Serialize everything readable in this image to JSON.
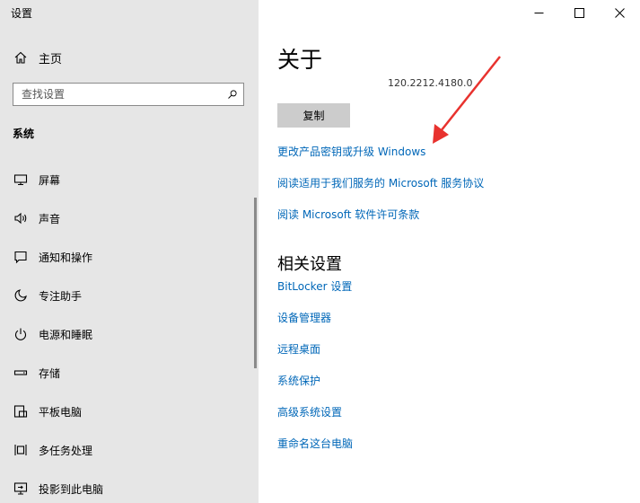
{
  "window": {
    "title": "设置",
    "controls": {
      "minimize_icon": "minimize-icon",
      "maximize_icon": "maximize-icon",
      "close_icon": "close-icon"
    }
  },
  "sidebar": {
    "home": {
      "label": "主页",
      "icon": "home-icon"
    },
    "search": {
      "placeholder": "查找设置",
      "icon": "search-icon"
    },
    "section": "系统",
    "items": [
      {
        "label": "屏幕",
        "icon": "display-icon"
      },
      {
        "label": "声音",
        "icon": "speaker-icon"
      },
      {
        "label": "通知和操作",
        "icon": "notification-icon"
      },
      {
        "label": "专注助手",
        "icon": "moon-icon"
      },
      {
        "label": "电源和睡眠",
        "icon": "power-icon"
      },
      {
        "label": "存储",
        "icon": "storage-icon"
      },
      {
        "label": "平板电脑",
        "icon": "tablet-icon"
      },
      {
        "label": "多任务处理",
        "icon": "multitask-icon"
      },
      {
        "label": "投影到此电脑",
        "icon": "project-icon"
      }
    ]
  },
  "main": {
    "title": "关于",
    "version": "120.2212.4180.0",
    "copy_button": "复制",
    "links": [
      "更改产品密钥或升级 Windows",
      "阅读适用于我们服务的 Microsoft 服务协议",
      "阅读 Microsoft 软件许可条款"
    ],
    "related_title": "相关设置",
    "related_links": [
      "BitLocker 设置",
      "设备管理器",
      "远程桌面",
      "系统保护",
      "高级系统设置",
      "重命名这台电脑"
    ]
  },
  "colors": {
    "sidebar_bg": "#e6e6e6",
    "link": "#0067b8",
    "arrow": "#e8322e"
  }
}
